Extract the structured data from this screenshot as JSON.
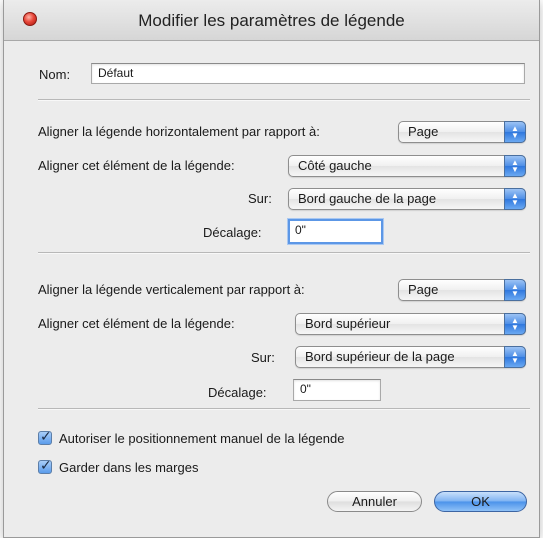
{
  "window": {
    "title": "Modifier les paramètres de légende"
  },
  "name": {
    "label": "Nom:",
    "value": "Défaut"
  },
  "horizontal": {
    "align_label": "Aligner la légende horizontalement par rapport à:",
    "align_value": "Page",
    "element_label": "Aligner cet élément de la légende:",
    "element_value": "Côté gauche",
    "on_label": "Sur:",
    "on_value": "Bord gauche de la page",
    "offset_label": "Décalage:",
    "offset_value": "0\""
  },
  "vertical": {
    "align_label": "Aligner la légende verticalement par rapport à:",
    "align_value": "Page",
    "element_label": "Aligner cet élément de la légende:",
    "element_value": "Bord supérieur",
    "on_label": "Sur:",
    "on_value": "Bord supérieur de la page",
    "offset_label": "Décalage:",
    "offset_value": "0\""
  },
  "options": {
    "manual_positioning": {
      "label": "Autoriser le positionnement manuel de la légende",
      "checked": true
    },
    "keep_in_margins": {
      "label": "Garder dans les marges",
      "checked": true
    }
  },
  "buttons": {
    "cancel": "Annuler",
    "ok": "OK"
  },
  "icons": {
    "close": "close-icon",
    "popup_arrows": "chevron-updown-icon",
    "check": "checkmark-icon"
  },
  "colors": {
    "accent": "#4d8ee6",
    "close": "#e8473a"
  }
}
